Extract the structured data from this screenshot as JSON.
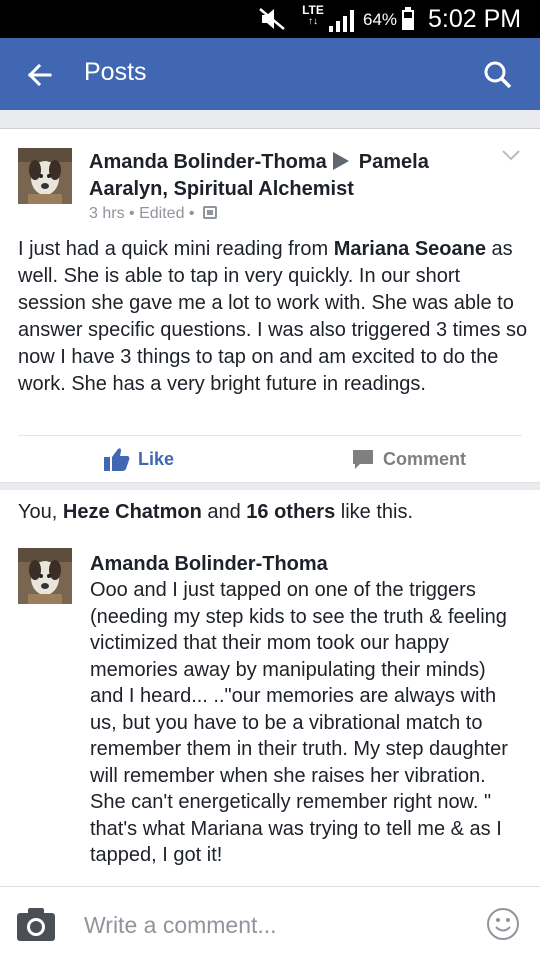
{
  "status_bar": {
    "network": "LTE",
    "network_sub": "↑↓",
    "battery": "64%",
    "time": "5:02 PM"
  },
  "app_bar": {
    "title": "Posts",
    "back_icon": "arrow-left-icon",
    "search_icon": "search-icon"
  },
  "post": {
    "author": "Amanda Bolinder-Thoma",
    "target_line1": "Pamela",
    "target_line2": "Aaralyn, Spiritual Alchemist",
    "time": "3 hrs",
    "edited": "Edited",
    "separator": "•",
    "body_pre": "I just had a quick mini reading from ",
    "body_mention": "Mariana Seoane",
    "body_post": " as well. She is able to tap in very quickly. In our short session she gave me a lot to work with. She was able to answer specific questions. I was also triggered 3 times so now I have 3 things to tap on and am excited to do the work. She has a very bright future in readings.",
    "like_label": "Like",
    "comment_label": "Comment"
  },
  "likes": {
    "prefix": "You, ",
    "name": "Heze Chatmon",
    "middle": " and ",
    "others": "16 others",
    "suffix": " like this."
  },
  "comment": {
    "author": "Amanda Bolinder-Thoma",
    "text": "Ooo and I just tapped on one of the triggers (needing my step kids to see the truth & feeling victimized that their mom took our happy memories away by manipulating their minds) and I heard... ..\"our memories are always with us, but you have to be a vibrational match to remember them in their truth. My step daughter will remember when she raises her vibration. She can't energetically remember right now. \" that's what Mariana was trying to tell me & as I tapped, I got it!"
  },
  "composer": {
    "placeholder": "Write a comment..."
  },
  "colors": {
    "brand_blue": "#4267b2",
    "text": "#1d2129",
    "meta": "#90949c"
  }
}
